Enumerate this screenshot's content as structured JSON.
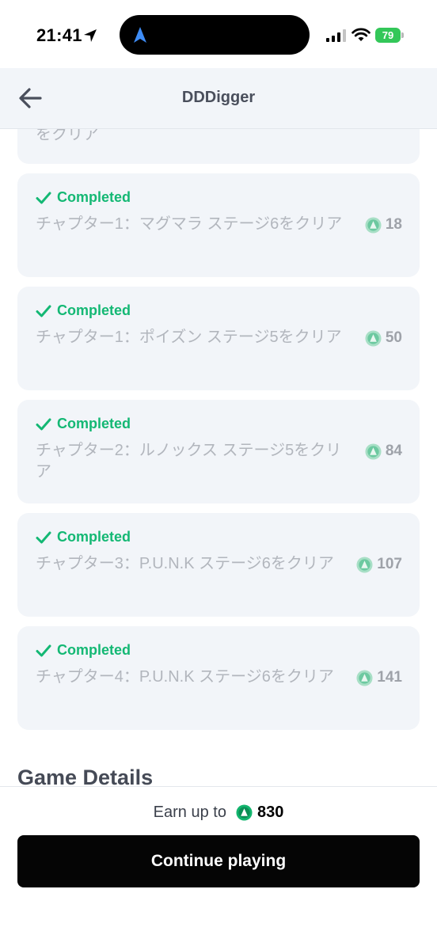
{
  "status_bar": {
    "time": "21:41",
    "battery": "79",
    "icons": [
      "location-arrow-icon",
      "navigation-icon",
      "cellular-signal-icon",
      "wifi-icon",
      "battery-icon"
    ]
  },
  "header": {
    "title": "DDDigger",
    "back_icon": "arrow-left-icon"
  },
  "quests": {
    "partial_label": "をクリア",
    "items": [
      {
        "status": "Completed",
        "text": "チャプター1：マグマラ ステージ6をクリア",
        "reward": "18"
      },
      {
        "status": "Completed",
        "text": "チャプター1：ポイズン ステージ5をクリア",
        "reward": "50"
      },
      {
        "status": "Completed",
        "text": "チャプター2：ルノックス ステージ5をクリア",
        "reward": "84"
      },
      {
        "status": "Completed",
        "text": "チャプター3：P.U.N.K ステージ6をクリア",
        "reward": "107"
      },
      {
        "status": "Completed",
        "text": "チャプター4：P.U.N.K ステージ6をクリア",
        "reward": "141"
      }
    ]
  },
  "section": {
    "title": "Game Details"
  },
  "footer": {
    "earn_label": "Earn up to",
    "earn_value": "830",
    "button_label": "Continue playing"
  },
  "colors": {
    "completed": "#14b874",
    "coin": "#12b56e",
    "card_bg": "#f2f5f9",
    "button_bg": "#050505"
  }
}
